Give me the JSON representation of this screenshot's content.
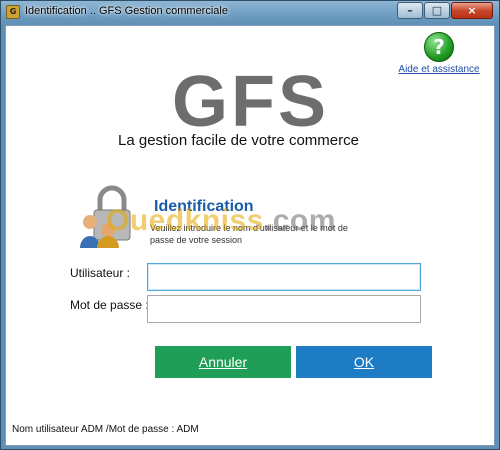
{
  "window": {
    "title": "Identification .. GFS Gestion commerciale",
    "app_icon": "gfs-app-icon",
    "controls": {
      "minimize": "–",
      "maximize": "□",
      "close": "×"
    }
  },
  "help": {
    "icon": "help-question-icon",
    "label": "Aide et assistance"
  },
  "brand": {
    "logo": "GFS",
    "tagline": "La gestion facile de votre commerce"
  },
  "identification": {
    "title": "Identification",
    "description": "Veuillez introduire le nom d'utilisateur et le mot de passe de votre session"
  },
  "watermark": {
    "part1": "Ouedkniss",
    "part2": ".com"
  },
  "form": {
    "user_label": "Utilisateur :",
    "user_value": "",
    "password_label": "Mot de passe :",
    "password_value": ""
  },
  "buttons": {
    "cancel_label": "Annuler",
    "ok_label": "OK"
  },
  "footer": {
    "hint": "Nom utilisateur ADM /Mot de passe : ADM"
  },
  "colors": {
    "cancel": "#1e9e57",
    "ok": "#1d7cc4",
    "title_accent": "#1a5ca8"
  }
}
